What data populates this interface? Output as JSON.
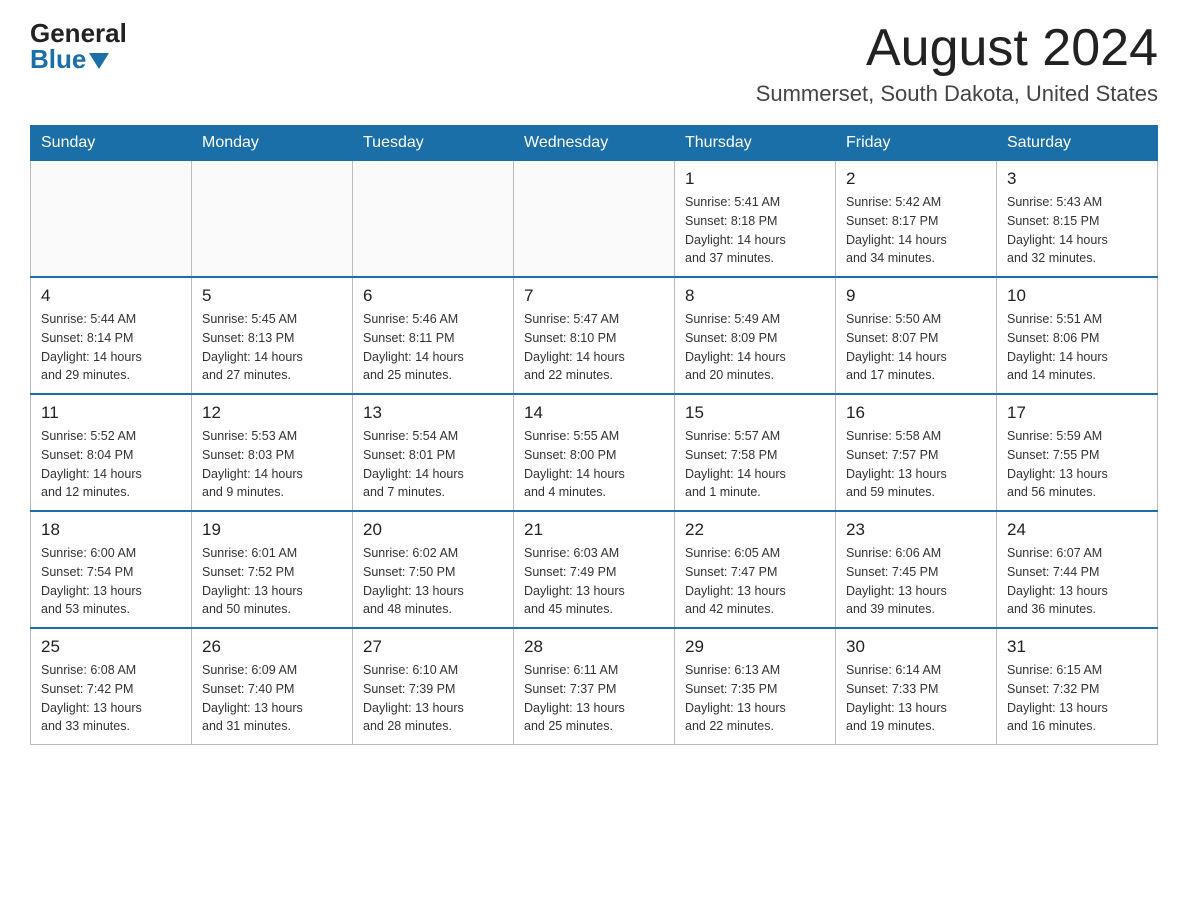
{
  "header": {
    "logo_general": "General",
    "logo_blue": "Blue",
    "month_title": "August 2024",
    "location": "Summerset, South Dakota, United States"
  },
  "days_of_week": [
    "Sunday",
    "Monday",
    "Tuesday",
    "Wednesday",
    "Thursday",
    "Friday",
    "Saturday"
  ],
  "weeks": [
    [
      {
        "day": "",
        "info": ""
      },
      {
        "day": "",
        "info": ""
      },
      {
        "day": "",
        "info": ""
      },
      {
        "day": "",
        "info": ""
      },
      {
        "day": "1",
        "info": "Sunrise: 5:41 AM\nSunset: 8:18 PM\nDaylight: 14 hours\nand 37 minutes."
      },
      {
        "day": "2",
        "info": "Sunrise: 5:42 AM\nSunset: 8:17 PM\nDaylight: 14 hours\nand 34 minutes."
      },
      {
        "day": "3",
        "info": "Sunrise: 5:43 AM\nSunset: 8:15 PM\nDaylight: 14 hours\nand 32 minutes."
      }
    ],
    [
      {
        "day": "4",
        "info": "Sunrise: 5:44 AM\nSunset: 8:14 PM\nDaylight: 14 hours\nand 29 minutes."
      },
      {
        "day": "5",
        "info": "Sunrise: 5:45 AM\nSunset: 8:13 PM\nDaylight: 14 hours\nand 27 minutes."
      },
      {
        "day": "6",
        "info": "Sunrise: 5:46 AM\nSunset: 8:11 PM\nDaylight: 14 hours\nand 25 minutes."
      },
      {
        "day": "7",
        "info": "Sunrise: 5:47 AM\nSunset: 8:10 PM\nDaylight: 14 hours\nand 22 minutes."
      },
      {
        "day": "8",
        "info": "Sunrise: 5:49 AM\nSunset: 8:09 PM\nDaylight: 14 hours\nand 20 minutes."
      },
      {
        "day": "9",
        "info": "Sunrise: 5:50 AM\nSunset: 8:07 PM\nDaylight: 14 hours\nand 17 minutes."
      },
      {
        "day": "10",
        "info": "Sunrise: 5:51 AM\nSunset: 8:06 PM\nDaylight: 14 hours\nand 14 minutes."
      }
    ],
    [
      {
        "day": "11",
        "info": "Sunrise: 5:52 AM\nSunset: 8:04 PM\nDaylight: 14 hours\nand 12 minutes."
      },
      {
        "day": "12",
        "info": "Sunrise: 5:53 AM\nSunset: 8:03 PM\nDaylight: 14 hours\nand 9 minutes."
      },
      {
        "day": "13",
        "info": "Sunrise: 5:54 AM\nSunset: 8:01 PM\nDaylight: 14 hours\nand 7 minutes."
      },
      {
        "day": "14",
        "info": "Sunrise: 5:55 AM\nSunset: 8:00 PM\nDaylight: 14 hours\nand 4 minutes."
      },
      {
        "day": "15",
        "info": "Sunrise: 5:57 AM\nSunset: 7:58 PM\nDaylight: 14 hours\nand 1 minute."
      },
      {
        "day": "16",
        "info": "Sunrise: 5:58 AM\nSunset: 7:57 PM\nDaylight: 13 hours\nand 59 minutes."
      },
      {
        "day": "17",
        "info": "Sunrise: 5:59 AM\nSunset: 7:55 PM\nDaylight: 13 hours\nand 56 minutes."
      }
    ],
    [
      {
        "day": "18",
        "info": "Sunrise: 6:00 AM\nSunset: 7:54 PM\nDaylight: 13 hours\nand 53 minutes."
      },
      {
        "day": "19",
        "info": "Sunrise: 6:01 AM\nSunset: 7:52 PM\nDaylight: 13 hours\nand 50 minutes."
      },
      {
        "day": "20",
        "info": "Sunrise: 6:02 AM\nSunset: 7:50 PM\nDaylight: 13 hours\nand 48 minutes."
      },
      {
        "day": "21",
        "info": "Sunrise: 6:03 AM\nSunset: 7:49 PM\nDaylight: 13 hours\nand 45 minutes."
      },
      {
        "day": "22",
        "info": "Sunrise: 6:05 AM\nSunset: 7:47 PM\nDaylight: 13 hours\nand 42 minutes."
      },
      {
        "day": "23",
        "info": "Sunrise: 6:06 AM\nSunset: 7:45 PM\nDaylight: 13 hours\nand 39 minutes."
      },
      {
        "day": "24",
        "info": "Sunrise: 6:07 AM\nSunset: 7:44 PM\nDaylight: 13 hours\nand 36 minutes."
      }
    ],
    [
      {
        "day": "25",
        "info": "Sunrise: 6:08 AM\nSunset: 7:42 PM\nDaylight: 13 hours\nand 33 minutes."
      },
      {
        "day": "26",
        "info": "Sunrise: 6:09 AM\nSunset: 7:40 PM\nDaylight: 13 hours\nand 31 minutes."
      },
      {
        "day": "27",
        "info": "Sunrise: 6:10 AM\nSunset: 7:39 PM\nDaylight: 13 hours\nand 28 minutes."
      },
      {
        "day": "28",
        "info": "Sunrise: 6:11 AM\nSunset: 7:37 PM\nDaylight: 13 hours\nand 25 minutes."
      },
      {
        "day": "29",
        "info": "Sunrise: 6:13 AM\nSunset: 7:35 PM\nDaylight: 13 hours\nand 22 minutes."
      },
      {
        "day": "30",
        "info": "Sunrise: 6:14 AM\nSunset: 7:33 PM\nDaylight: 13 hours\nand 19 minutes."
      },
      {
        "day": "31",
        "info": "Sunrise: 6:15 AM\nSunset: 7:32 PM\nDaylight: 13 hours\nand 16 minutes."
      }
    ]
  ]
}
